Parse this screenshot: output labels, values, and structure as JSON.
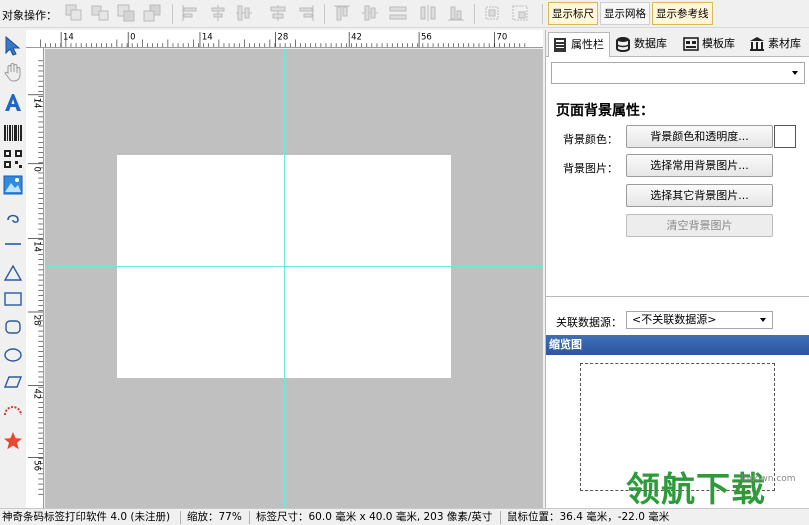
{
  "toolbar": {
    "label": "对象操作：",
    "buttons": {
      "show_ruler": "显示标尺",
      "show_grid": "显示网格",
      "show_guides": "显示参考线"
    }
  },
  "ruler": {
    "h_labels": [
      "14",
      "0",
      "14",
      "28",
      "42",
      "56",
      "70"
    ],
    "v_labels": [
      "14",
      "0",
      "14",
      "28",
      "42",
      "56"
    ]
  },
  "panel": {
    "tabs": {
      "properties": "属性栏",
      "database": "数据库",
      "templates": "模板库",
      "materials": "素材库"
    },
    "combo_value": "",
    "section_title": "页面背景属性：",
    "bg_color_label": "背景颜色：",
    "bg_color_button": "背景颜色和透明度...",
    "bg_color_value": "#ffffff",
    "bg_image_label": "背景图片：",
    "bg_image_common_button": "选择常用背景图片...",
    "bg_image_other_button": "选择其它背景图片...",
    "bg_image_clear_button": "清空背景图片",
    "datasource_label": "关联数据源：",
    "datasource_value": "<不关联数据源>",
    "preview_title": "缩览图",
    "watermark": "领航下载",
    "watermark_url": "lhdown.com"
  },
  "status": {
    "app": "神奇条码标签打印软件 4.0 (未注册)",
    "zoom": "缩放：77%",
    "label_size": "标签尺寸：60.0 毫米 x 40.0 毫米, 203 像素/英寸",
    "mouse_pos": "鼠标位置：36.4 毫米，-22.0 毫米"
  },
  "colors": {
    "canvas_bg": "#c0c0c0",
    "guide": "#6fe8e0",
    "preview_header": "#2c56a0",
    "watermark": "#2e9b3a"
  }
}
